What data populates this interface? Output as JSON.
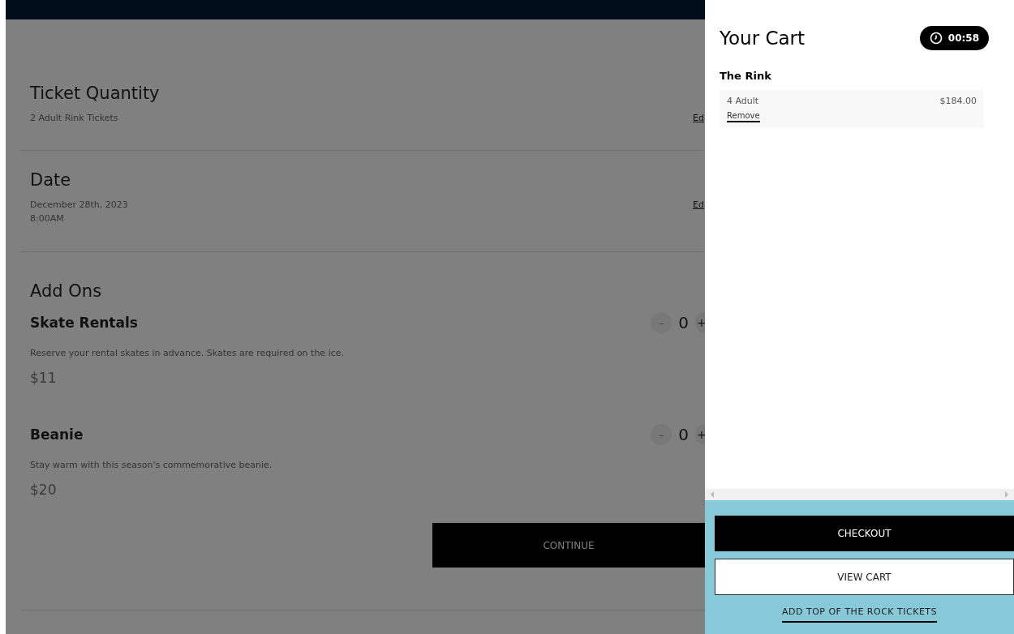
{
  "summary": [
    {
      "title": "Ticket Quantity",
      "lines": [
        "2 Adult Rink Tickets"
      ],
      "edit": "Ed"
    },
    {
      "title": "Date",
      "lines": [
        "December 28th, 2023",
        "8:00AM"
      ],
      "edit": "Ed"
    }
  ],
  "add_ons": {
    "title": "Add Ons",
    "items": [
      {
        "name": "Skate Rentals",
        "description": "Reserve your rental skates in advance. Skates are required on the ice.",
        "price": "$11",
        "minus": "–",
        "quantity": "0",
        "plus": "+"
      },
      {
        "name": "Beanie",
        "description": "Stay warm with this season's commemorative beanie.",
        "price": "$20",
        "minus": "–",
        "quantity": "0",
        "plus": "+"
      }
    ]
  },
  "continue_button": "CONTINUE",
  "cart": {
    "title": "Your Cart",
    "timer": "00:58",
    "venue": "The Rink",
    "items": [
      {
        "label": "4 Adult",
        "price": "$184.00",
        "remove": "Remove"
      }
    ],
    "checkout": "CHECKOUT",
    "view_cart": "VIEW CART",
    "add_link": "ADD TOP OF THE ROCK TICKETS"
  }
}
